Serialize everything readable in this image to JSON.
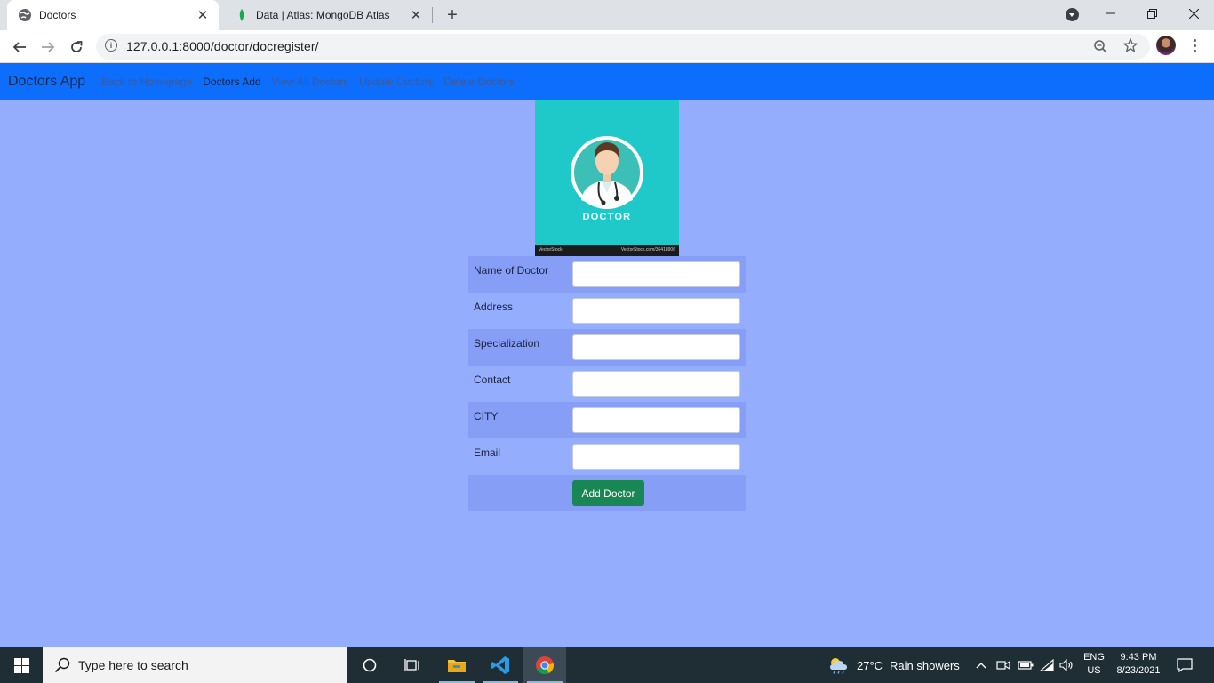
{
  "browser": {
    "tabs": [
      {
        "title": "Doctors",
        "active": true
      },
      {
        "title": "Data | Atlas: MongoDB Atlas",
        "active": false
      }
    ],
    "url": "127.0.0.1:8000/doctor/docregister/"
  },
  "navbar": {
    "brand": "Doctors App",
    "links": [
      "Back to Homepage",
      "Doctors Add",
      "View All Doctors",
      "Update Doctors",
      "Delete Doctors"
    ],
    "active_link": "Doctors Add",
    "color": "#0d6efd"
  },
  "hero_image": {
    "label": "DOCTOR",
    "stock_left": "VectorStock",
    "stock_right": "VectorStock.com/36418906"
  },
  "form": {
    "fields": [
      {
        "label": "Name of Doctor",
        "value": ""
      },
      {
        "label": "Address",
        "value": ""
      },
      {
        "label": "Specialization",
        "value": ""
      },
      {
        "label": "Contact",
        "value": ""
      },
      {
        "label": "CITY",
        "value": ""
      },
      {
        "label": "Email",
        "value": ""
      }
    ],
    "submit_label": "Add Doctor",
    "submit_color": "#198754"
  },
  "taskbar": {
    "search_placeholder": "Type here to search",
    "weather": {
      "temp": "27°C",
      "condition": "Rain showers"
    },
    "language": {
      "lang": "ENG",
      "region": "US"
    },
    "clock": {
      "time": "9:43 PM",
      "date": "8/23/2021"
    },
    "pinned": [
      "file-explorer-icon",
      "vscode-icon",
      "chrome-icon"
    ]
  },
  "page_background": "#94aefd"
}
